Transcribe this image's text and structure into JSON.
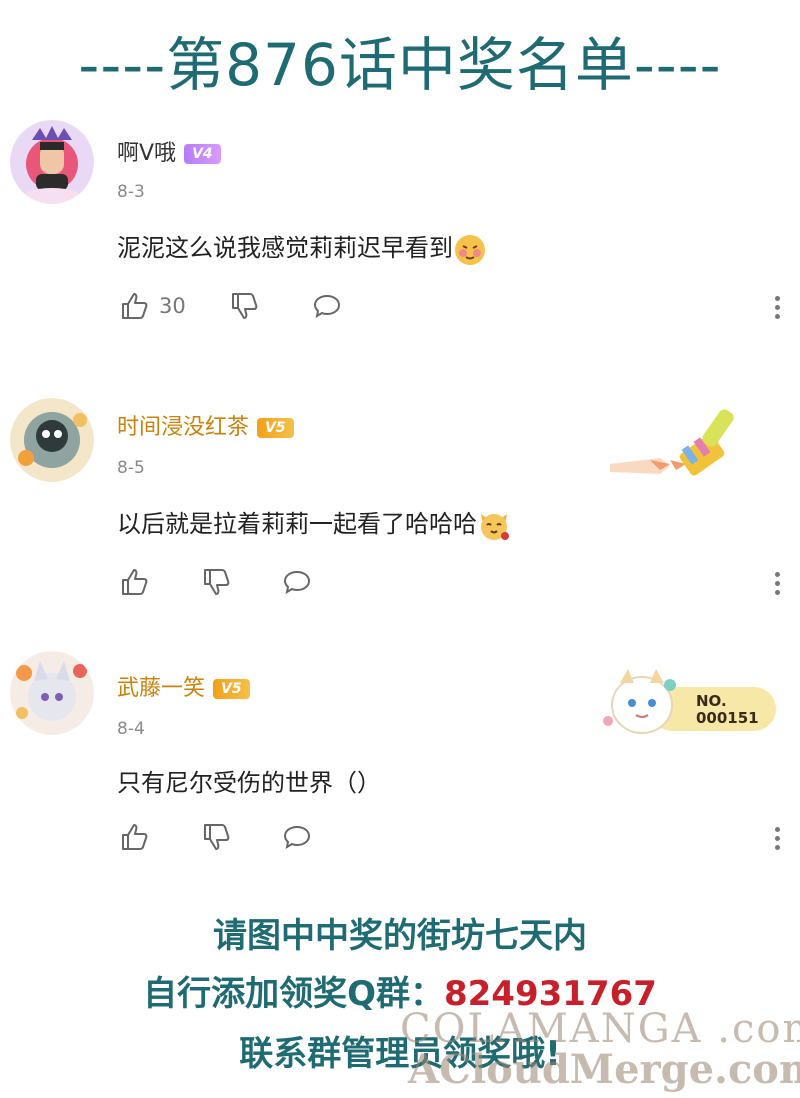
{
  "title": "----第876话中奖名单----",
  "comments": [
    {
      "username": "啊V哦",
      "level": "V4",
      "date": "8-3",
      "text": "泥泥这么说我感觉莉莉迟早看到",
      "emoji": "blush-face",
      "likes": "30"
    },
    {
      "username": "时间浸没红茶",
      "level": "V5",
      "date": "8-5",
      "text": "以后就是拉着莉莉一起看了哈哈哈",
      "emoji": "cat-face"
    },
    {
      "username": "武藤一笑",
      "level": "V5",
      "date": "8-4",
      "text": "只有尼尔受伤的世界（）",
      "badge": "NO.\n000151"
    }
  ],
  "footer": {
    "line1": "请图中中奖的街坊七天内",
    "line2_prefix": "自行添加领奖Q群：",
    "line2_qq": "824931767",
    "line3": "联系群管理员领奖哦!"
  },
  "watermark": {
    "line1": "COLAMANGA .com",
    "line2": "ACloudMerge.com"
  },
  "colors": {
    "title": "#1f6b73",
    "qq_number": "#c8202a",
    "v4_badge": "#b67cf5",
    "v5_badge": "#f2a01c"
  }
}
